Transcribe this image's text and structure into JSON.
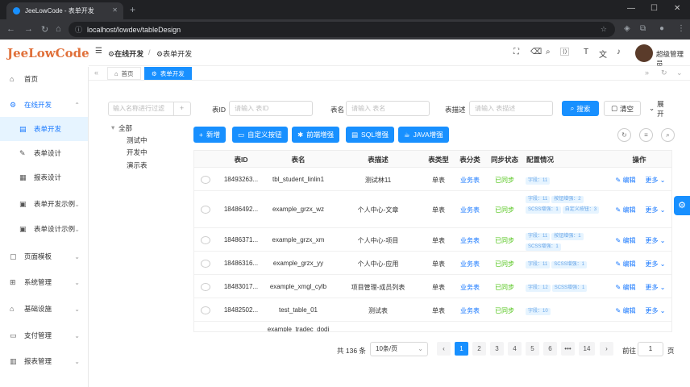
{
  "browser": {
    "tab_title": "JeeLowCode - 表单开发",
    "url": "localhost/lowdev/tableDesign"
  },
  "logo": {
    "text": "JeeLowCode"
  },
  "sidebar": {
    "items": [
      {
        "label": "首页",
        "icon": "home-icon"
      },
      {
        "label": "在线开发",
        "icon": "dev-icon"
      },
      {
        "label": "表单开发",
        "icon": "form-icon"
      },
      {
        "label": "表单设计",
        "icon": "form-design-icon"
      },
      {
        "label": "报表设计",
        "icon": "report-design-icon"
      },
      {
        "label": "表单开发示例",
        "icon": "example-icon"
      },
      {
        "label": "表单设计示例",
        "icon": "example-icon"
      },
      {
        "label": "页面模板",
        "icon": "template-icon"
      },
      {
        "label": "系统管理",
        "icon": "system-icon"
      },
      {
        "label": "基础设施",
        "icon": "infra-icon"
      },
      {
        "label": "支付管理",
        "icon": "pay-icon"
      },
      {
        "label": "报表管理",
        "icon": "report-icon"
      }
    ]
  },
  "header": {
    "breadcrumb_1": "在线开发",
    "breadcrumb_sep": "/",
    "breadcrumb_2": "表单开发",
    "username": "超级管理员"
  },
  "page_tabs": [
    {
      "label": "首页"
    },
    {
      "label": "表单开发"
    }
  ],
  "tree": {
    "search_placeholder": "输入名称进行过滤",
    "nodes": [
      "全部",
      "测试中",
      "开发中",
      "演示表"
    ]
  },
  "filters": {
    "table_id_label": "表ID",
    "table_id_placeholder": "请输入 表ID",
    "table_name_label": "表名",
    "table_name_placeholder": "请输入 表名",
    "table_desc_label": "表描述",
    "table_desc_placeholder": "请输入 表描述",
    "search": "搜索",
    "reset": "清空",
    "expand": "展开"
  },
  "toolbar": {
    "new": "新增",
    "custom_button": "自定义按钮",
    "frontend_enhance": "前端增强",
    "sql_enhance": "SQL增强",
    "java_enhance": "JAVA增强"
  },
  "table": {
    "headers": [
      "表ID",
      "表名",
      "表描述",
      "表类型",
      "表分类",
      "同步状态",
      "配置情况",
      "操作"
    ],
    "rows": [
      {
        "id": "18493263...",
        "name": "tbl_student_linlin1",
        "desc": "测试林11",
        "type": "单表",
        "cat": "业务表",
        "sync": "已同步",
        "tags": [
          "字段：11"
        ],
        "edit": "编辑",
        "more": "更多"
      },
      {
        "id": "18486492...",
        "name": "example_grzx_wz",
        "desc": "个人中心-文章",
        "type": "单表",
        "cat": "业务表",
        "sync": "已同步",
        "tags": [
          "字段：11",
          "按钮增强：2",
          "SCSS增强：1",
          "自定义按钮：3"
        ],
        "edit": "编辑",
        "more": "更多"
      },
      {
        "id": "18486371...",
        "name": "example_grzx_xm",
        "desc": "个人中心-项目",
        "type": "单表",
        "cat": "业务表",
        "sync": "已同步",
        "tags": [
          "字段：11",
          "按钮增强：1",
          "SCSS增强：1"
        ],
        "edit": "编辑",
        "more": "更多"
      },
      {
        "id": "18486316...",
        "name": "example_grzx_yy",
        "desc": "个人中心-应用",
        "type": "单表",
        "cat": "业务表",
        "sync": "已同步",
        "tags": [
          "字段：11",
          "SCSS增强：1"
        ],
        "edit": "编辑",
        "more": "更多"
      },
      {
        "id": "18483017...",
        "name": "example_xmgl_cylb",
        "desc": "项目管理-成员列表",
        "type": "单表",
        "cat": "业务表",
        "sync": "已同步",
        "tags": [
          "字段：12",
          "SCSS增强：1"
        ],
        "edit": "编辑",
        "more": "更多"
      },
      {
        "id": "18482502...",
        "name": "test_table_01",
        "desc": "测试表",
        "type": "单表",
        "cat": "业务表",
        "sync": "已同步",
        "tags": [
          "字段：10"
        ],
        "edit": "编辑",
        "more": "更多"
      },
      {
        "id": "",
        "name": "example_tradec_dodi",
        "desc": "",
        "type": "",
        "cat": "",
        "sync": "",
        "tags": [],
        "edit": "",
        "more": ""
      }
    ]
  },
  "pagination": {
    "total": "共 136 条",
    "page_size": "10条/页",
    "pages": [
      "1",
      "2",
      "3",
      "4",
      "5",
      "6",
      "•••",
      "14"
    ],
    "goto_label": "前往",
    "goto_value": "1",
    "page_unit": "页"
  }
}
